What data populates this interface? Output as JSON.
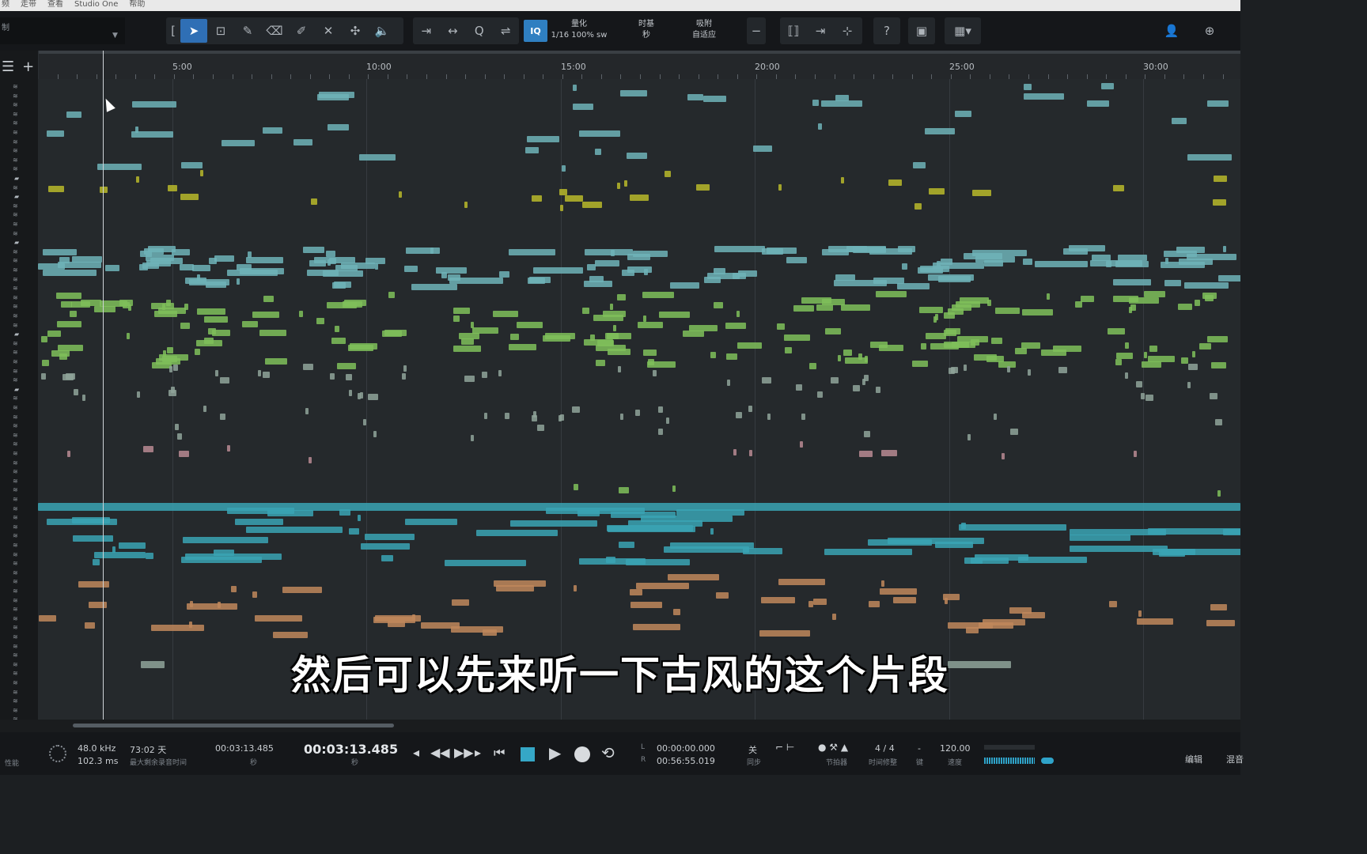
{
  "menu": [
    "频",
    "走带",
    "查看",
    "Studio One",
    "帮助"
  ],
  "toolbar": {
    "left_label": "制",
    "quantize": {
      "label": "量化",
      "value": "1/16 100% sw"
    },
    "timebase": {
      "label": "时基",
      "value": "秒"
    },
    "snap": {
      "label": "吸附",
      "value": "自适应"
    },
    "iq_label": "IQ",
    "help_label": "?"
  },
  "ruler": {
    "labels": [
      "5:00",
      "10:00",
      "15:00",
      "20:00",
      "25:00",
      "30:00"
    ]
  },
  "transport": {
    "sample_rate": "48.0 kHz",
    "latency": "102.3 ms",
    "performance_label": "性能",
    "record_time": "73:02 天",
    "record_time_label": "最大剩余录音时间",
    "position_small": "00:03:13.485",
    "position_small_unit": "秒",
    "position_big": "00:03:13.485",
    "position_big_unit": "秒",
    "loop_L_label": "L",
    "loop_R_label": "R",
    "loop_start": "00:00:00.000",
    "loop_end": "00:56:55.019",
    "sync_value": "关",
    "sync_label": "同步",
    "metronome_label": "节拍器",
    "time_sig": "4 / 4",
    "time_sig_label": "时间修整",
    "key_value": "-",
    "key_label": "键",
    "tempo": "120.00",
    "tempo_label": "速度",
    "edit_label": "编辑",
    "mix_label": "混音"
  },
  "subtitle": "然后可以先来听一下古风的这个片段",
  "colors": {
    "teal": "#6fb3b8",
    "yellow": "#b8b82a",
    "green": "#7fbf5a",
    "pink": "#b98a93",
    "blue": "#3aa3b4",
    "orange": "#c0875c",
    "greengray": "#8fa39a"
  }
}
